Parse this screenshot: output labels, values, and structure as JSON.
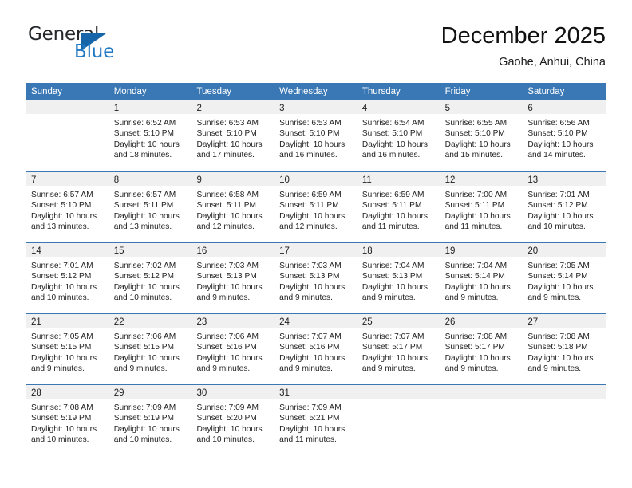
{
  "brand": {
    "name_top": "General",
    "name_bottom": "Blue",
    "triangle_icon": "blue-triangle-icon",
    "accent_color": "#2079c4"
  },
  "header": {
    "title": "December 2025",
    "subtitle": "Gaohe, Anhui, China"
  },
  "theme": {
    "header_bg": "#3a78b5",
    "day_band_bg": "#f0f0f0",
    "text_color": "#232323"
  },
  "weekdays": [
    "Sunday",
    "Monday",
    "Tuesday",
    "Wednesday",
    "Thursday",
    "Friday",
    "Saturday"
  ],
  "weeks": [
    [
      {
        "day": "",
        "lines": []
      },
      {
        "day": "1",
        "lines": [
          "Sunrise: 6:52 AM",
          "Sunset: 5:10 PM",
          "Daylight: 10 hours",
          "and 18 minutes."
        ]
      },
      {
        "day": "2",
        "lines": [
          "Sunrise: 6:53 AM",
          "Sunset: 5:10 PM",
          "Daylight: 10 hours",
          "and 17 minutes."
        ]
      },
      {
        "day": "3",
        "lines": [
          "Sunrise: 6:53 AM",
          "Sunset: 5:10 PM",
          "Daylight: 10 hours",
          "and 16 minutes."
        ]
      },
      {
        "day": "4",
        "lines": [
          "Sunrise: 6:54 AM",
          "Sunset: 5:10 PM",
          "Daylight: 10 hours",
          "and 16 minutes."
        ]
      },
      {
        "day": "5",
        "lines": [
          "Sunrise: 6:55 AM",
          "Sunset: 5:10 PM",
          "Daylight: 10 hours",
          "and 15 minutes."
        ]
      },
      {
        "day": "6",
        "lines": [
          "Sunrise: 6:56 AM",
          "Sunset: 5:10 PM",
          "Daylight: 10 hours",
          "and 14 minutes."
        ]
      }
    ],
    [
      {
        "day": "7",
        "lines": [
          "Sunrise: 6:57 AM",
          "Sunset: 5:10 PM",
          "Daylight: 10 hours",
          "and 13 minutes."
        ]
      },
      {
        "day": "8",
        "lines": [
          "Sunrise: 6:57 AM",
          "Sunset: 5:11 PM",
          "Daylight: 10 hours",
          "and 13 minutes."
        ]
      },
      {
        "day": "9",
        "lines": [
          "Sunrise: 6:58 AM",
          "Sunset: 5:11 PM",
          "Daylight: 10 hours",
          "and 12 minutes."
        ]
      },
      {
        "day": "10",
        "lines": [
          "Sunrise: 6:59 AM",
          "Sunset: 5:11 PM",
          "Daylight: 10 hours",
          "and 12 minutes."
        ]
      },
      {
        "day": "11",
        "lines": [
          "Sunrise: 6:59 AM",
          "Sunset: 5:11 PM",
          "Daylight: 10 hours",
          "and 11 minutes."
        ]
      },
      {
        "day": "12",
        "lines": [
          "Sunrise: 7:00 AM",
          "Sunset: 5:11 PM",
          "Daylight: 10 hours",
          "and 11 minutes."
        ]
      },
      {
        "day": "13",
        "lines": [
          "Sunrise: 7:01 AM",
          "Sunset: 5:12 PM",
          "Daylight: 10 hours",
          "and 10 minutes."
        ]
      }
    ],
    [
      {
        "day": "14",
        "lines": [
          "Sunrise: 7:01 AM",
          "Sunset: 5:12 PM",
          "Daylight: 10 hours",
          "and 10 minutes."
        ]
      },
      {
        "day": "15",
        "lines": [
          "Sunrise: 7:02 AM",
          "Sunset: 5:12 PM",
          "Daylight: 10 hours",
          "and 10 minutes."
        ]
      },
      {
        "day": "16",
        "lines": [
          "Sunrise: 7:03 AM",
          "Sunset: 5:13 PM",
          "Daylight: 10 hours",
          "and 9 minutes."
        ]
      },
      {
        "day": "17",
        "lines": [
          "Sunrise: 7:03 AM",
          "Sunset: 5:13 PM",
          "Daylight: 10 hours",
          "and 9 minutes."
        ]
      },
      {
        "day": "18",
        "lines": [
          "Sunrise: 7:04 AM",
          "Sunset: 5:13 PM",
          "Daylight: 10 hours",
          "and 9 minutes."
        ]
      },
      {
        "day": "19",
        "lines": [
          "Sunrise: 7:04 AM",
          "Sunset: 5:14 PM",
          "Daylight: 10 hours",
          "and 9 minutes."
        ]
      },
      {
        "day": "20",
        "lines": [
          "Sunrise: 7:05 AM",
          "Sunset: 5:14 PM",
          "Daylight: 10 hours",
          "and 9 minutes."
        ]
      }
    ],
    [
      {
        "day": "21",
        "lines": [
          "Sunrise: 7:05 AM",
          "Sunset: 5:15 PM",
          "Daylight: 10 hours",
          "and 9 minutes."
        ]
      },
      {
        "day": "22",
        "lines": [
          "Sunrise: 7:06 AM",
          "Sunset: 5:15 PM",
          "Daylight: 10 hours",
          "and 9 minutes."
        ]
      },
      {
        "day": "23",
        "lines": [
          "Sunrise: 7:06 AM",
          "Sunset: 5:16 PM",
          "Daylight: 10 hours",
          "and 9 minutes."
        ]
      },
      {
        "day": "24",
        "lines": [
          "Sunrise: 7:07 AM",
          "Sunset: 5:16 PM",
          "Daylight: 10 hours",
          "and 9 minutes."
        ]
      },
      {
        "day": "25",
        "lines": [
          "Sunrise: 7:07 AM",
          "Sunset: 5:17 PM",
          "Daylight: 10 hours",
          "and 9 minutes."
        ]
      },
      {
        "day": "26",
        "lines": [
          "Sunrise: 7:08 AM",
          "Sunset: 5:17 PM",
          "Daylight: 10 hours",
          "and 9 minutes."
        ]
      },
      {
        "day": "27",
        "lines": [
          "Sunrise: 7:08 AM",
          "Sunset: 5:18 PM",
          "Daylight: 10 hours",
          "and 9 minutes."
        ]
      }
    ],
    [
      {
        "day": "28",
        "lines": [
          "Sunrise: 7:08 AM",
          "Sunset: 5:19 PM",
          "Daylight: 10 hours",
          "and 10 minutes."
        ]
      },
      {
        "day": "29",
        "lines": [
          "Sunrise: 7:09 AM",
          "Sunset: 5:19 PM",
          "Daylight: 10 hours",
          "and 10 minutes."
        ]
      },
      {
        "day": "30",
        "lines": [
          "Sunrise: 7:09 AM",
          "Sunset: 5:20 PM",
          "Daylight: 10 hours",
          "and 10 minutes."
        ]
      },
      {
        "day": "31",
        "lines": [
          "Sunrise: 7:09 AM",
          "Sunset: 5:21 PM",
          "Daylight: 10 hours",
          "and 11 minutes."
        ]
      },
      {
        "day": "",
        "lines": []
      },
      {
        "day": "",
        "lines": []
      },
      {
        "day": "",
        "lines": []
      }
    ]
  ]
}
